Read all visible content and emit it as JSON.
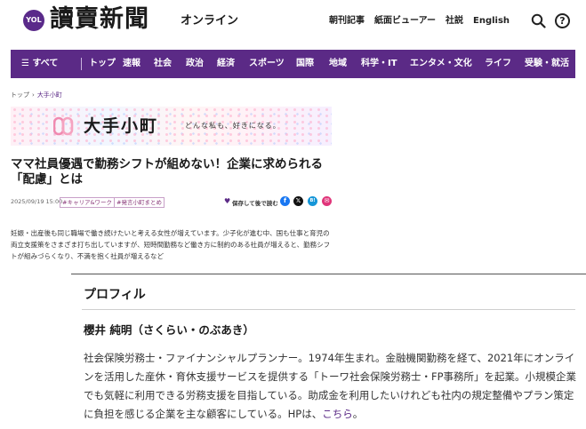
{
  "header": {
    "logo_badge": "YOL",
    "logo_text": "讀賣新聞",
    "logo_sub": "オンライン",
    "links": [
      "朝刊記事",
      "紙面ビューアー",
      "社説",
      "English"
    ],
    "icons": [
      "search-icon",
      "help-icon"
    ],
    "help_glyph": "?"
  },
  "nav": {
    "menu_label": "すべて",
    "items": [
      "トップ",
      "速報",
      "社会",
      "政治",
      "経済",
      "スポーツ",
      "国際",
      "地域",
      "科学・IT",
      "エンタメ・文化",
      "ライフ",
      "受験・就活"
    ],
    "bg_color": "#5b2a86"
  },
  "breadcrumb": {
    "home": "トップ",
    "current": "大手小町"
  },
  "banner": {
    "title": "大手小町",
    "tagline": "どんな私も、好きになる。"
  },
  "article": {
    "headline": "ママ社員優遇で勤務シフトが組めない！企業に求められる「配慮」とは",
    "date": "2025/09/19 15:00",
    "tags": [
      "#キャリア&ワーク",
      "#発言小町まとめ"
    ],
    "save_label": "保存して後で読む",
    "share_icons": [
      "facebook-icon",
      "x-icon",
      "hatena-icon",
      "mail-icon"
    ],
    "body": "妊娠・出産後も同じ職場で働き続けたいと考える女性が増えています。少子化が進む中、国も仕事と育児の両立支援策をさまざま打ち出していますが、短時間勤務など働き方に制約のある社員が増えると、勤務シフトが組みづらくなり、不満を抱く社員が増えるなど"
  },
  "profile": {
    "title": "プロフィル",
    "name": "櫻井 純明（さくらい・のぶあき）",
    "bio": "社会保険労務士・ファイナンシャルプランナー。1974年生まれ。金融機関勤務を経て、2021年にオンラインを活用した産休・育休支援サービスを提供する「トーワ社会保険労務士・FP事務所」を起業。小規模企業でも気軽に利用できる労務支援を目指している。助成金を利用したいけれども社内の規定整備やプラン策定に負担を感じる企業を主な顧客にしている。HPは、",
    "link_text": "こちら",
    "bio_end": "。"
  }
}
